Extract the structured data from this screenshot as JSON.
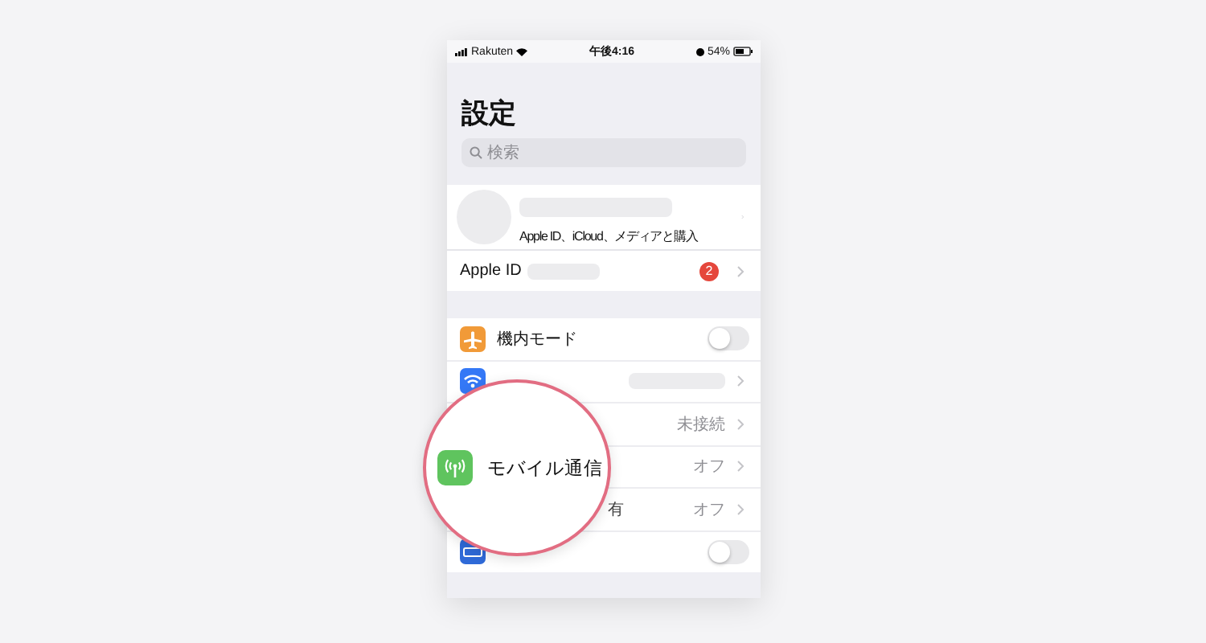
{
  "status_bar": {
    "carrier": "Rakuten",
    "time": "午後4:16",
    "battery": "54%"
  },
  "title": "設定",
  "search": {
    "placeholder": "検索"
  },
  "account": {
    "subtitle": "Apple ID、iCloud、メディアと購入",
    "apple_id_label": "Apple ID",
    "badge": "2"
  },
  "rows": [
    {
      "kind": "toggle",
      "label": "機内モード",
      "on": false
    },
    {
      "kind": "link",
      "value_blurred": true
    },
    {
      "kind": "link",
      "value": "未接続"
    },
    {
      "kind": "link",
      "value": "オフ"
    },
    {
      "kind": "link",
      "label": "有",
      "value": "オフ"
    },
    {
      "kind": "toggle",
      "on": false
    }
  ],
  "magnifier": {
    "label": "モバイル通信"
  }
}
